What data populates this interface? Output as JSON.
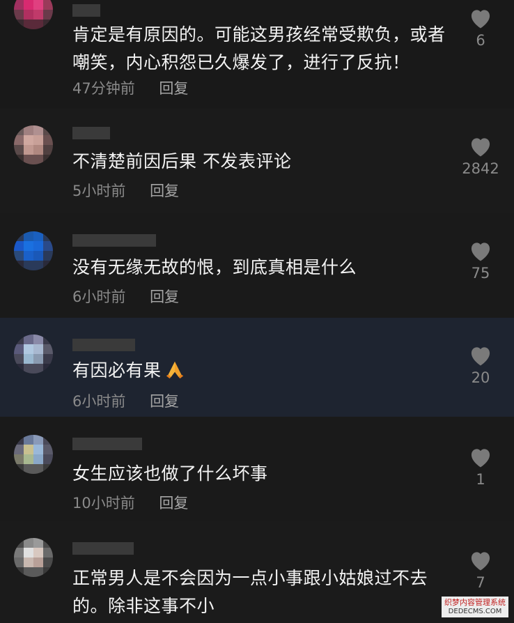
{
  "comments": [
    {
      "text": "肯定是有原因的。可能这男孩经常受欺负，或者嘲笑，内心积怨已久爆发了，进行了反抗！",
      "time": "47分钟前",
      "reply": "回复",
      "likes": "6"
    },
    {
      "text": "不清楚前因后果 不发表评论",
      "time": "5小时前",
      "reply": "回复",
      "likes": "2842"
    },
    {
      "text": "没有无缘无故的恨，到底真相是什么",
      "time": "6小时前",
      "reply": "回复",
      "likes": "75"
    },
    {
      "text": "有因必有果",
      "emoji": "folded-hands-emoji",
      "time": "6小时前",
      "reply": "回复",
      "likes": "20",
      "highlighted": true
    },
    {
      "text": "女生应该也做了什么坏事",
      "time": "10小时前",
      "reply": "回复",
      "likes": "1"
    },
    {
      "text": "正常男人是不会因为一点小事跟小姑娘过不去的。除非这事不小",
      "time": "",
      "reply": "",
      "likes": "7"
    }
  ],
  "watermark": {
    "line1": "织梦内容管理系统",
    "line2": "DEDECMS.COM"
  },
  "colors": {
    "background": "#161616",
    "highlight_background": "#1e2430",
    "text": "#f3f3f3",
    "meta": "#8a8a8a",
    "heart": "#7a7a7a"
  }
}
